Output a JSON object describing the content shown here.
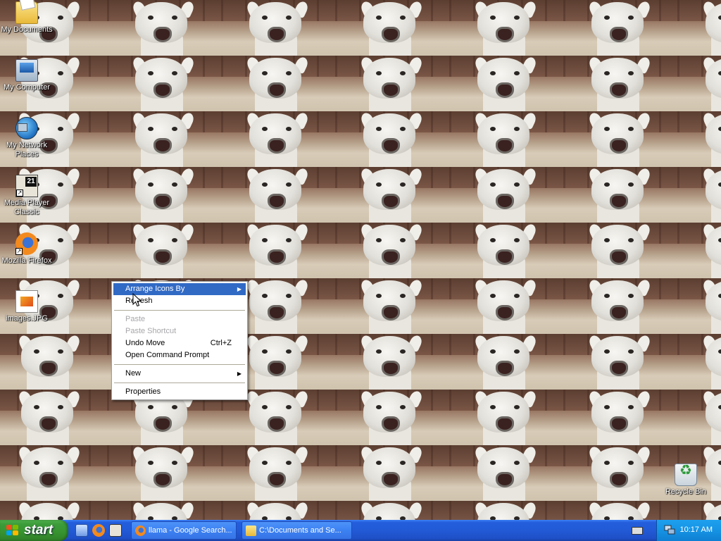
{
  "desktop": {
    "icons": [
      {
        "label": "My Documents",
        "icon": "my-documents-icon"
      },
      {
        "label": "My Computer",
        "icon": "my-computer-icon"
      },
      {
        "label": "My Network Places",
        "icon": "my-network-places-icon"
      },
      {
        "label": "Media Player Classic",
        "icon": "media-player-classic-icon"
      },
      {
        "label": "Mozilla Firefox",
        "icon": "firefox-icon"
      },
      {
        "label": "images.JPG",
        "icon": "jpg-image-icon"
      },
      {
        "label": "Recycle Bin",
        "icon": "recycle-bin-icon"
      }
    ]
  },
  "context_menu": {
    "items": [
      {
        "label": "Arrange Icons By",
        "submenu": true,
        "highlighted": true
      },
      {
        "label": "Refresh"
      },
      {
        "label": "Paste",
        "disabled": true
      },
      {
        "label": "Paste Shortcut",
        "disabled": true
      },
      {
        "label": "Undo Move",
        "shortcut": "Ctrl+Z"
      },
      {
        "label": "Open Command Prompt"
      },
      {
        "label": "New",
        "submenu": true
      },
      {
        "label": "Properties"
      }
    ]
  },
  "taskbar": {
    "start_label": "start",
    "quick_launch": [
      "show-desktop-icon",
      "firefox-icon",
      "media-player-classic-icon"
    ],
    "tasks": [
      {
        "label": "llama - Google Search...",
        "icon": "firefox-icon"
      },
      {
        "label": "C:\\Documents and Se...",
        "icon": "folder-icon"
      }
    ],
    "clock": "10:17 AM"
  },
  "colors": {
    "taskbar_blue": "#245edc",
    "start_green": "#3c9c3a",
    "menu_highlight": "#316ac5",
    "menu_disabled_text": "#a7a6aa",
    "tray_blue": "#1693e4"
  }
}
